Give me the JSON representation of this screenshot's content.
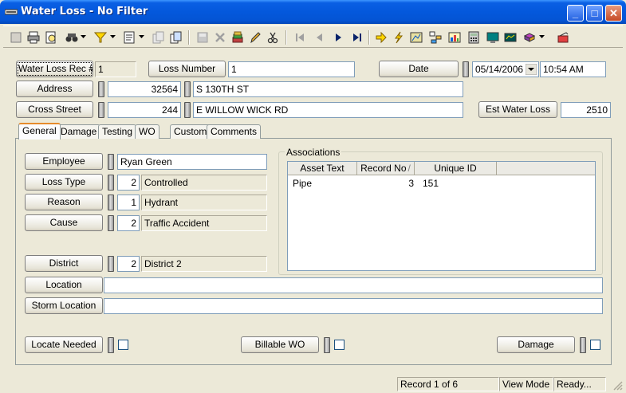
{
  "window": {
    "title": "Water Loss - No Filter",
    "minimize": "_",
    "maximize": "□",
    "close": "✕"
  },
  "toolbar": {
    "icons": [
      "new-record-icon",
      "print-icon",
      "print-preview-icon",
      "search-binoculars-icon",
      "filter-icon",
      "report-icon",
      "copy-disabled-icon",
      "duplicate-icon",
      "save-disabled-icon",
      "delete-disabled-icon",
      "attach-icon",
      "edit-pencil-icon",
      "cut-scissors-icon",
      "first-record-icon",
      "previous-record-icon",
      "next-record-icon",
      "last-record-icon",
      "goto-arrow-icon",
      "lightning-icon",
      "map-icon",
      "tree-icon",
      "chart-icon",
      "calculator-icon",
      "monitor-icon",
      "books-icon",
      "close-folder-icon"
    ]
  },
  "header": {
    "rec_label": "Water Loss Rec #",
    "rec_value": "1",
    "loss_number_label": "Loss Number",
    "loss_number_value": "1",
    "date_label": "Date",
    "date_value": "05/14/2006",
    "time_value": "10:54 AM",
    "address_label": "Address",
    "address_number": "32564",
    "address_street": "S 130TH ST",
    "cross_street_label": "Cross Street",
    "cross_number": "244",
    "cross_street": "E WILLOW WICK RD",
    "est_water_loss_label": "Est Water Loss",
    "est_water_loss_value": "2510"
  },
  "tabs": [
    "General",
    "Damage",
    "Testing",
    "WO",
    "Custom",
    "Comments"
  ],
  "general": {
    "employee_label": "Employee",
    "employee_value": "Ryan Green",
    "loss_type_label": "Loss Type",
    "loss_type_code": "2",
    "loss_type_value": "Controlled",
    "reason_label": "Reason",
    "reason_code": "1",
    "reason_value": "Hydrant",
    "cause_label": "Cause",
    "cause_code": "2",
    "cause_value": "Traffic Accident",
    "district_label": "District",
    "district_code": "2",
    "district_value": "District 2",
    "location_label": "Location",
    "location_value": "",
    "storm_location_label": "Storm Location",
    "storm_location_value": "",
    "locate_needed_label": "Locate Needed",
    "billable_wo_label": "Billable WO",
    "damage_label": "Damage"
  },
  "associations": {
    "title": "Associations",
    "columns": [
      "Asset Text",
      "Record No",
      "Unique ID"
    ],
    "sort_indicator": "/",
    "rows": [
      {
        "asset_text": "Pipe",
        "record_no": "3",
        "unique_id": "151"
      }
    ]
  },
  "status": {
    "record": "Record 1 of 6",
    "mode": "View Mode",
    "state": "Ready..."
  }
}
